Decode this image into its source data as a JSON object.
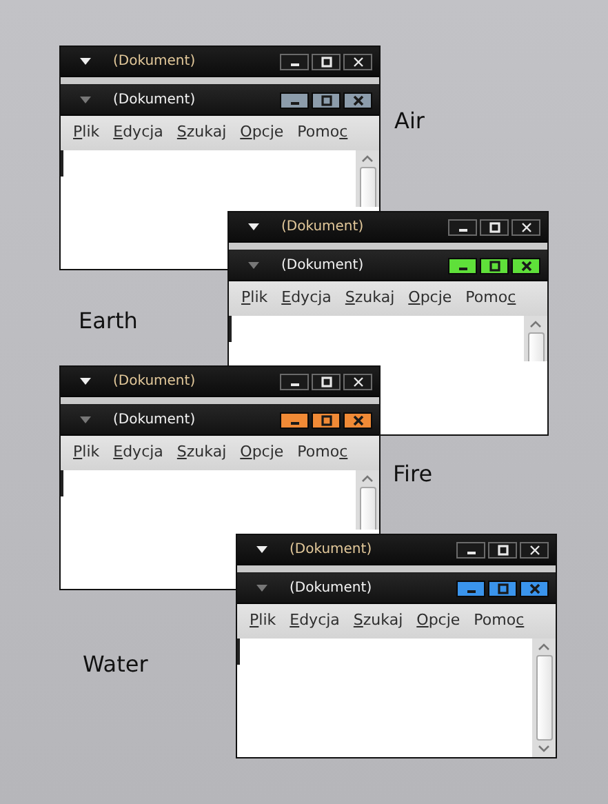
{
  "themes": [
    {
      "name": "Air",
      "color": "#8c9cab",
      "title_bars": [
        {
          "title": "(Dokument)",
          "active": false
        },
        {
          "title": "(Dokument)",
          "active": true
        }
      ],
      "menu": [
        {
          "parts": [
            {
              "text": "P",
              "underline": true
            },
            {
              "text": "lik",
              "underline": false
            }
          ]
        },
        {
          "parts": [
            {
              "text": "E",
              "underline": true
            },
            {
              "text": "dycja",
              "underline": false
            }
          ]
        },
        {
          "parts": [
            {
              "text": "S",
              "underline": true
            },
            {
              "text": "zukaj",
              "underline": false
            }
          ]
        },
        {
          "parts": [
            {
              "text": "O",
              "underline": true
            },
            {
              "text": "pcje",
              "underline": false
            }
          ]
        },
        {
          "parts": [
            {
              "text": "Pomo",
              "underline": false
            },
            {
              "text": "c",
              "underline": true
            }
          ]
        }
      ]
    },
    {
      "name": "Earth",
      "color": "#5fe03a",
      "title_bars": [
        {
          "title": "(Dokument)",
          "active": false
        },
        {
          "title": "(Dokument)",
          "active": true
        }
      ],
      "menu": [
        {
          "parts": [
            {
              "text": "P",
              "underline": true
            },
            {
              "text": "lik",
              "underline": false
            }
          ]
        },
        {
          "parts": [
            {
              "text": "E",
              "underline": true
            },
            {
              "text": "dycja",
              "underline": false
            }
          ]
        },
        {
          "parts": [
            {
              "text": "S",
              "underline": true
            },
            {
              "text": "zukaj",
              "underline": false
            }
          ]
        },
        {
          "parts": [
            {
              "text": "O",
              "underline": true
            },
            {
              "text": "pcje",
              "underline": false
            }
          ]
        },
        {
          "parts": [
            {
              "text": "Pomo",
              "underline": false
            },
            {
              "text": "c",
              "underline": true
            }
          ]
        }
      ]
    },
    {
      "name": "Fire",
      "color": "#f08a36",
      "title_bars": [
        {
          "title": "(Dokument)",
          "active": false
        },
        {
          "title": "(Dokument)",
          "active": true
        }
      ],
      "menu": [
        {
          "parts": [
            {
              "text": "P",
              "underline": true
            },
            {
              "text": "lik",
              "underline": false
            }
          ]
        },
        {
          "parts": [
            {
              "text": "E",
              "underline": true
            },
            {
              "text": "dycja",
              "underline": false
            }
          ]
        },
        {
          "parts": [
            {
              "text": "S",
              "underline": true
            },
            {
              "text": "zukaj",
              "underline": false
            }
          ]
        },
        {
          "parts": [
            {
              "text": "O",
              "underline": true
            },
            {
              "text": "pcje",
              "underline": false
            }
          ]
        },
        {
          "parts": [
            {
              "text": "Pomo",
              "underline": false
            },
            {
              "text": "c",
              "underline": true
            }
          ]
        }
      ]
    },
    {
      "name": "Water",
      "color": "#3a94ec",
      "title_bars": [
        {
          "title": "(Dokument)",
          "active": false
        },
        {
          "title": "(Dokument)",
          "active": true
        }
      ],
      "menu": [
        {
          "parts": [
            {
              "text": "P",
              "underline": true
            },
            {
              "text": "lik",
              "underline": false
            }
          ]
        },
        {
          "parts": [
            {
              "text": "E",
              "underline": true
            },
            {
              "text": "dycja",
              "underline": false
            }
          ]
        },
        {
          "parts": [
            {
              "text": "S",
              "underline": true
            },
            {
              "text": "zukaj",
              "underline": false
            }
          ]
        },
        {
          "parts": [
            {
              "text": "O",
              "underline": true
            },
            {
              "text": "pcje",
              "underline": false
            }
          ]
        },
        {
          "parts": [
            {
              "text": "Pomo",
              "underline": false
            },
            {
              "text": "c",
              "underline": true
            }
          ]
        }
      ]
    }
  ]
}
